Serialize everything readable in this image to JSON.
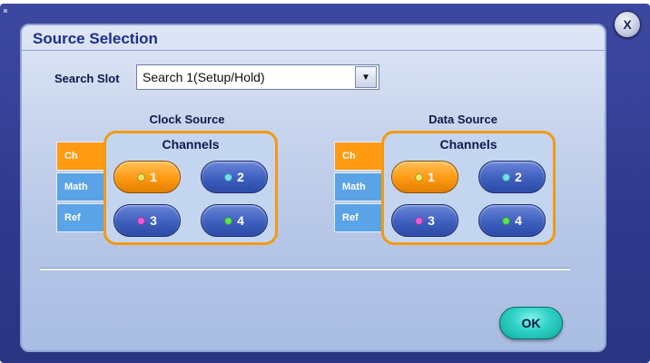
{
  "dialog": {
    "title": "Source Selection",
    "close_label": "X",
    "ok_label": "OK"
  },
  "search": {
    "label": "Search Slot",
    "value": "Search 1(Setup/Hold)",
    "arrow": "▼"
  },
  "clock": {
    "title": "Clock Source",
    "tabs": [
      {
        "label": "Ch",
        "active": true
      },
      {
        "label": "Math",
        "active": false
      },
      {
        "label": "Ref",
        "active": false
      }
    ],
    "channels_title": "Channels",
    "channels": [
      {
        "label": "1",
        "dot_color": "#f3e65a",
        "active": true
      },
      {
        "label": "2",
        "dot_color": "#6fe0f0",
        "active": false
      },
      {
        "label": "3",
        "dot_color": "#f05ad8",
        "active": false
      },
      {
        "label": "4",
        "dot_color": "#5ae05a",
        "active": false
      }
    ]
  },
  "data_source": {
    "title": "Data Source",
    "tabs": [
      {
        "label": "Ch",
        "active": true
      },
      {
        "label": "Math",
        "active": false
      },
      {
        "label": "Ref",
        "active": false
      }
    ],
    "channels_title": "Channels",
    "channels": [
      {
        "label": "1",
        "dot_color": "#f3e65a",
        "active": true
      },
      {
        "label": "2",
        "dot_color": "#6fe0f0",
        "active": false
      },
      {
        "label": "3",
        "dot_color": "#f05ad8",
        "active": false
      },
      {
        "label": "4",
        "dot_color": "#5ae05a",
        "active": false
      }
    ]
  },
  "colors": {
    "accent_orange": "#ff9a12",
    "tab_blue": "#5aa3e6",
    "title_blue": "#1b2f8f",
    "ok_teal": "#2ed1c6"
  }
}
